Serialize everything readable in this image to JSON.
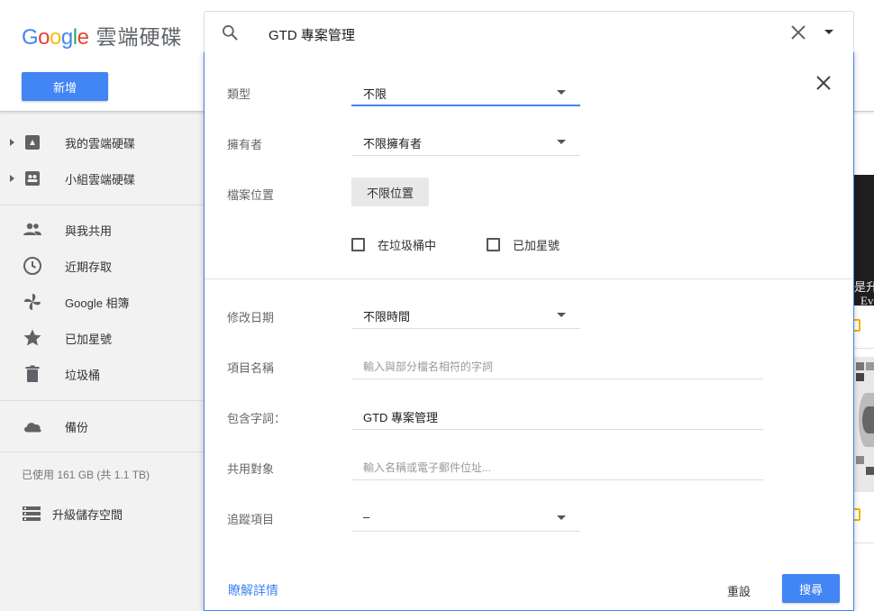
{
  "header": {
    "logo_letters": [
      "G",
      "o",
      "o",
      "g",
      "l",
      "e"
    ],
    "product_name": "雲端硬碟",
    "new_button": "新增"
  },
  "search": {
    "query": "GTD 專案管理",
    "icons": [
      "search-icon",
      "clear-icon",
      "dropdown-icon"
    ]
  },
  "sidebar": {
    "items": [
      {
        "label": "我的雲端硬碟",
        "icon": "my-drive-icon",
        "expandable": true
      },
      {
        "label": "小組雲端硬碟",
        "icon": "team-drive-icon",
        "expandable": true
      },
      {
        "label": "與我共用",
        "icon": "people-icon",
        "expandable": false
      },
      {
        "label": "近期存取",
        "icon": "clock-icon",
        "expandable": false
      },
      {
        "label": "Google 相簿",
        "icon": "photos-pinwheel-icon",
        "expandable": false
      },
      {
        "label": "已加星號",
        "icon": "star-icon",
        "expandable": false
      },
      {
        "label": "垃圾桶",
        "icon": "trash-icon",
        "expandable": false
      },
      {
        "label": "備份",
        "icon": "cloud-icon",
        "expandable": false
      }
    ],
    "storage_text": "已使用 161 GB (共 1.1 TB)",
    "upgrade_label": "升級儲存空間"
  },
  "background": {
    "partial_text_1": "是升",
    "partial_text_2": "Ev"
  },
  "advanced_search": {
    "type": {
      "label": "類型",
      "value": "不限"
    },
    "owner": {
      "label": "擁有者",
      "value": "不限擁有者"
    },
    "location": {
      "label": "檔案位置",
      "button": "不限位置"
    },
    "in_trash": {
      "label": "在垃圾桶中",
      "checked": false
    },
    "starred": {
      "label": "已加星號",
      "checked": false
    },
    "modified": {
      "label": "修改日期",
      "value": "不限時間"
    },
    "item_name": {
      "label": "項目名稱",
      "placeholder": "輸入與部分檔名相符的字詞",
      "value": ""
    },
    "has_words": {
      "label": "包含字詞：",
      "value": "GTD 專案管理"
    },
    "shared_with": {
      "label": "共用對象",
      "placeholder": "輸入名稱或電子郵件位址...",
      "value": ""
    },
    "follow_up": {
      "label": "追蹤項目",
      "value": "–"
    },
    "learn_more": "瞭解詳情",
    "reset": "重設",
    "search_button": "搜尋"
  },
  "colors": {
    "accent": "#4285f4",
    "sidebar_bg": "#f2f2f2",
    "star_ring": "#f4b400"
  }
}
